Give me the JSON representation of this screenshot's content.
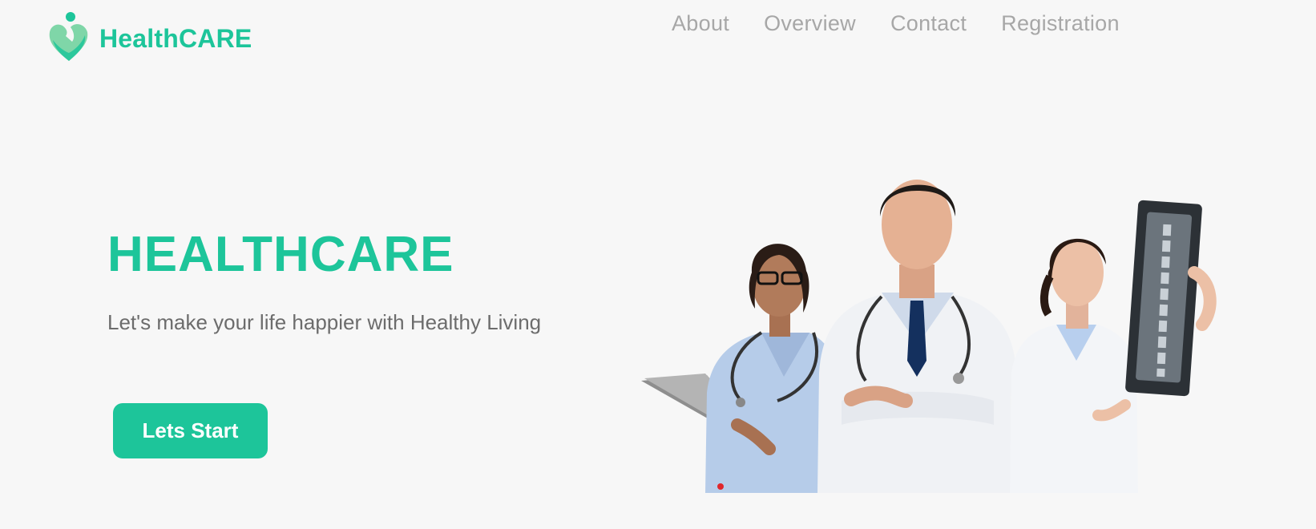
{
  "brand": {
    "name": "HealthCARE",
    "accent_color": "#1dc59a",
    "logo_icon": "heart-person-icon"
  },
  "nav": {
    "items": [
      {
        "label": "About"
      },
      {
        "label": "Overview"
      },
      {
        "label": "Contact"
      },
      {
        "label": "Registration"
      }
    ]
  },
  "hero": {
    "title": "HEALTHCARE",
    "subtitle": "Let's make your life happier with Healthy Living",
    "cta_label": "Lets Start",
    "image": "doctors-team-illustration",
    "carousel_indicator_color": "#e0262b"
  }
}
